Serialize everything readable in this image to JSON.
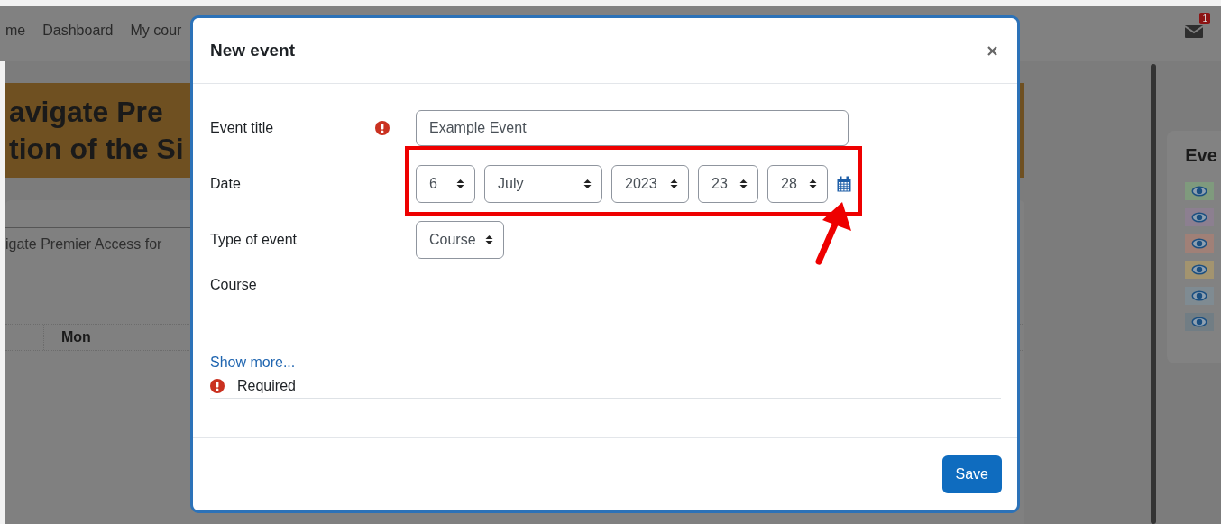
{
  "background": {
    "nav_items": [
      "me",
      "Dashboard",
      "My cour"
    ],
    "mail_badge": "1",
    "banner_lines": [
      "avigate Pre",
      "tion of the Si"
    ],
    "course_name": "igate Premier Access for",
    "calendar_header": "Mon",
    "side_panel": {
      "title": "Eve",
      "filters": [
        {
          "color": "#7f9a7d"
        },
        {
          "color": "#8c7f90"
        },
        {
          "color": "#a08077"
        },
        {
          "color": "#a3946f"
        },
        {
          "color": "#7f8b92"
        },
        {
          "color": "#717d84"
        }
      ]
    }
  },
  "modal": {
    "title": "New event",
    "fields": [
      {
        "kind": "text",
        "label": "Event title",
        "required": true,
        "value": "Example Event"
      },
      {
        "kind": "date",
        "label": "Date",
        "required": false,
        "selects": [
          "6",
          "July",
          "2023",
          "23",
          "28"
        ]
      },
      {
        "kind": "select",
        "label": "Type of event",
        "required": false,
        "value": "Course"
      },
      {
        "kind": "empty",
        "label": "Course",
        "required": false
      }
    ],
    "show_more": "Show more...",
    "required_note": "Required",
    "save": "Save"
  }
}
